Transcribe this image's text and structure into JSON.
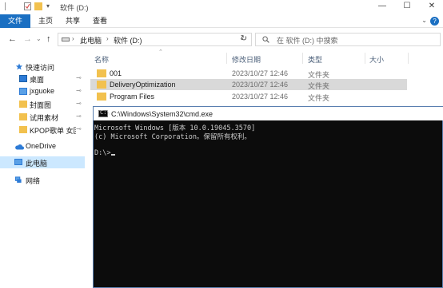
{
  "window": {
    "title": "软件 (D:)",
    "controls": {
      "minimize": "—",
      "maximize": "☐",
      "close": "✕"
    }
  },
  "ribbon": {
    "tabs": [
      "文件",
      "主页",
      "共享",
      "查看"
    ],
    "toggle": "⌄",
    "help": "?"
  },
  "nav": {
    "back": "←",
    "forward": "→",
    "recent": "⌄",
    "up": "↑",
    "address": [
      "此电脑",
      "软件 (D:)"
    ],
    "address_dropdown": "⌄",
    "refresh": "↻",
    "search_placeholder": "在 软件 (D:) 中搜索"
  },
  "sidebar": {
    "quick_access": "快速访问",
    "items": [
      {
        "label": "桌面",
        "pinned": true
      },
      {
        "label": "jxguoke",
        "pinned": true
      },
      {
        "label": "封面图",
        "pinned": true
      },
      {
        "label": "试用素材",
        "pinned": true
      },
      {
        "label": "KPOP歌单 女团",
        "pinned": true
      }
    ],
    "onedrive": "OneDrive",
    "this_pc": "此电脑",
    "network": "网络",
    "pin_glyph": "📌"
  },
  "filelist": {
    "columns": [
      "名称",
      "修改日期",
      "类型",
      "大小"
    ],
    "sort_glyph": "⌃",
    "rows": [
      {
        "name": "001",
        "date": "2023/10/27 12:46",
        "type": "文件夹",
        "size": ""
      },
      {
        "name": "DeliveryOptimization",
        "date": "2023/10/27 12:46",
        "type": "文件夹",
        "size": ""
      },
      {
        "name": "Program Files",
        "date": "2023/10/27 12:46",
        "type": "文件夹",
        "size": ""
      }
    ]
  },
  "cmd": {
    "title": "C:\\Windows\\System32\\cmd.exe",
    "icon_text": "C:\\",
    "lines": [
      "Microsoft Windows [版本 10.0.19045.3570]",
      "(c) Microsoft Corporation。保留所有权利。",
      "",
      "D:\\>"
    ]
  },
  "colors": {
    "accent": "#1a6fc2",
    "selection": "#cce8ff",
    "folder": "#f2c14e",
    "console_bg": "#0c0c0c",
    "console_text": "#cccccc"
  }
}
